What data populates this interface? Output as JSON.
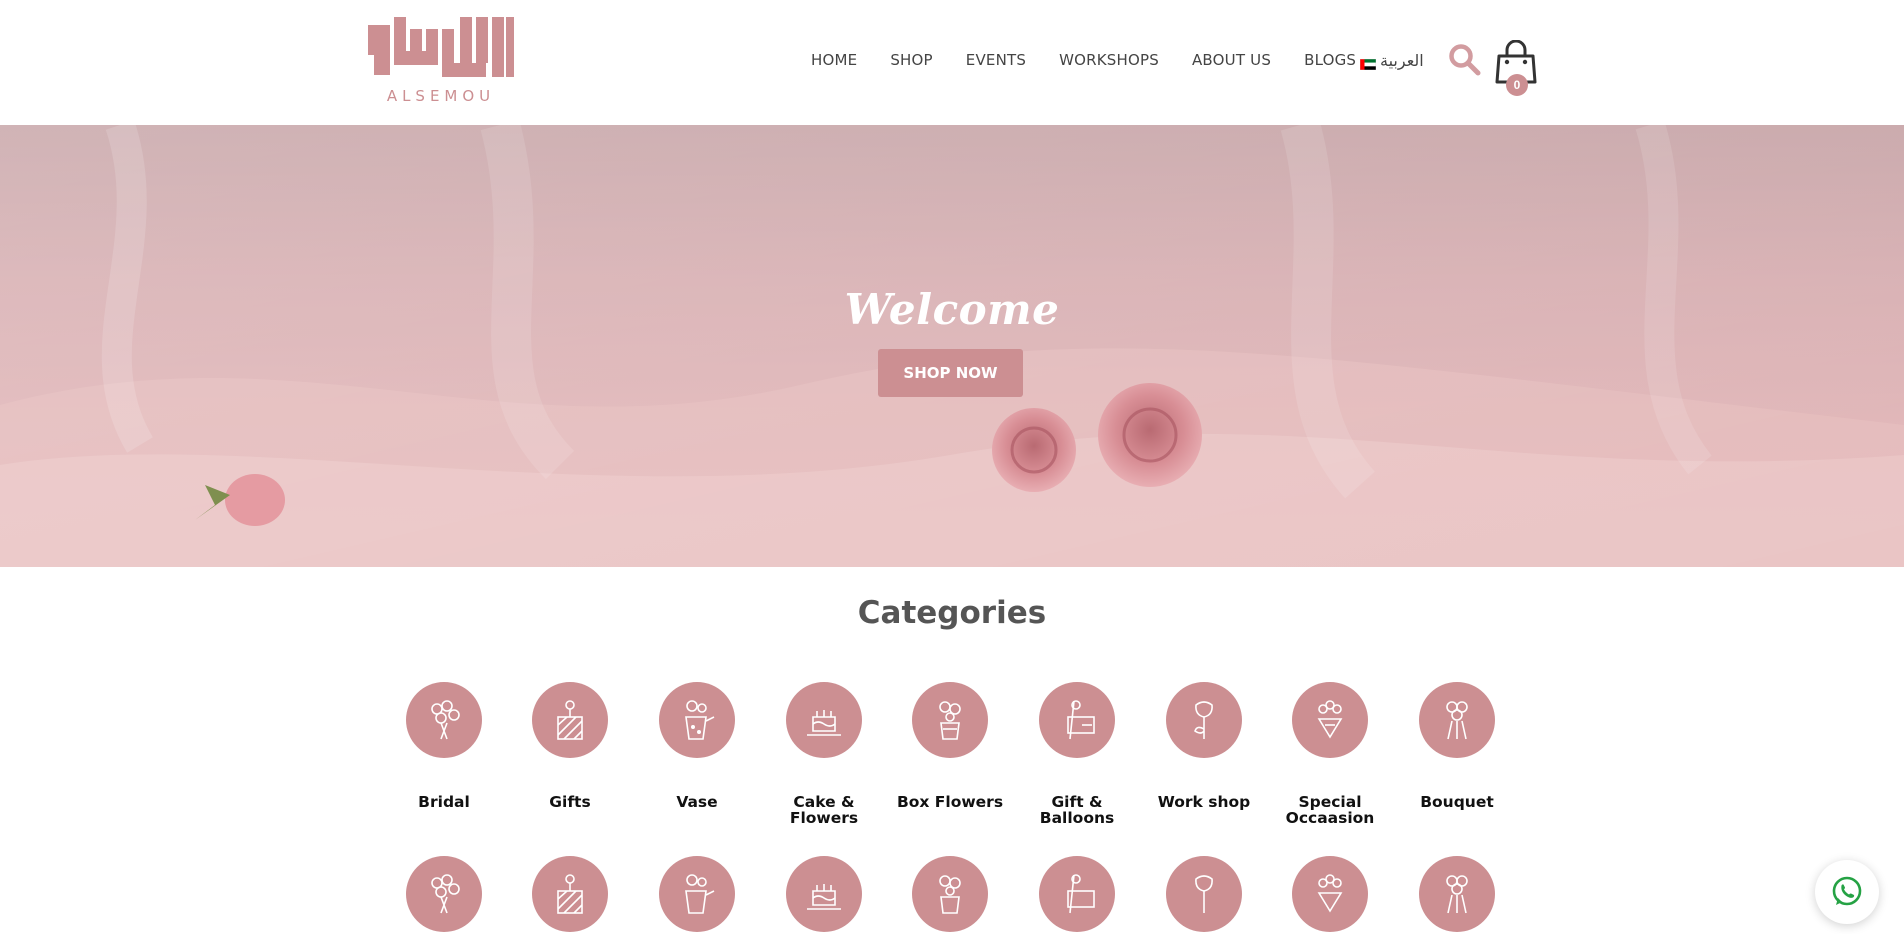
{
  "brand": {
    "logo_text": "ALSEMOU",
    "accent": "#cc8f92"
  },
  "nav": {
    "items": [
      {
        "label": "HOME"
      },
      {
        "label": "SHOP"
      },
      {
        "label": "EVENTS"
      },
      {
        "label": "WORKSHOPS"
      },
      {
        "label": "ABOUT US"
      },
      {
        "label": "BLOGS"
      }
    ],
    "language": "العربية",
    "cart_count": "0"
  },
  "hero": {
    "title": "Welcome",
    "button": "SHOP NOW"
  },
  "categories": {
    "title": "Categories",
    "items": [
      {
        "label": "Bridal",
        "icon": "bridal-bouquet-icon"
      },
      {
        "label": "Gifts",
        "icon": "gift-box-icon"
      },
      {
        "label": "Vase",
        "icon": "vase-icon"
      },
      {
        "label": "Cake & Flowers",
        "icon": "cake-icon"
      },
      {
        "label": "Box Flowers",
        "icon": "box-flowers-icon"
      },
      {
        "label": "Gift & Balloons",
        "icon": "gift-card-icon"
      },
      {
        "label": "Work shop",
        "icon": "single-flower-icon"
      },
      {
        "label": "Special Occaasion",
        "icon": "special-bouquet-icon"
      },
      {
        "label": "Bouquet",
        "icon": "bouquet-icon"
      }
    ]
  },
  "whatsapp": {
    "icon": "whatsapp-icon"
  }
}
